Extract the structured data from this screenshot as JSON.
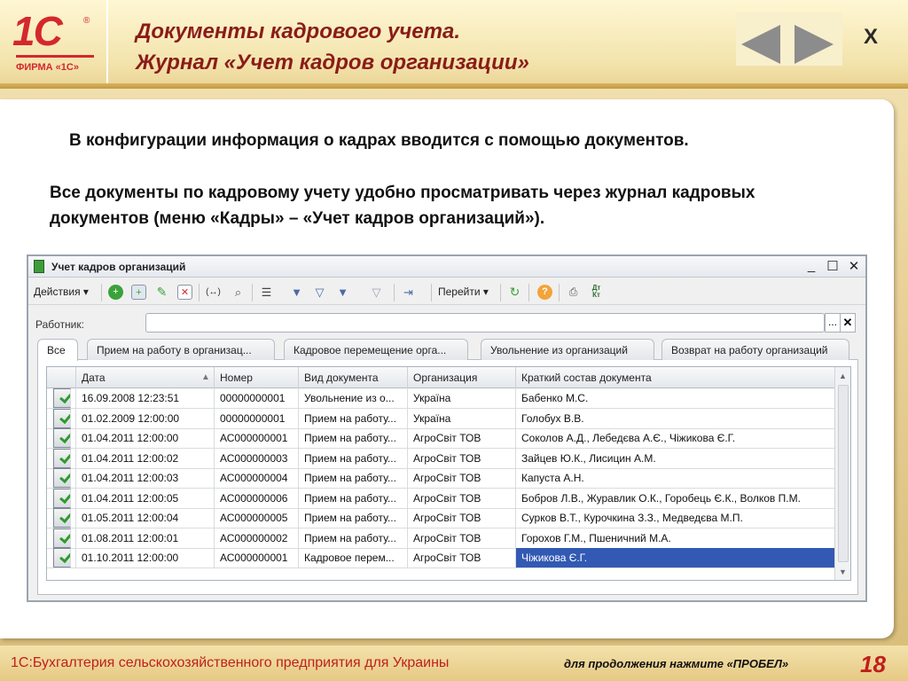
{
  "brand": {
    "logo_text": "1С",
    "registered": "®",
    "firm": "ФИРМА «1С»"
  },
  "header": {
    "title_line1": "Документы кадрового учета.",
    "title_line2": "Журнал «Учет кадров организации»",
    "close_label": "Х",
    "nav_icons": [
      "arrow-left-icon",
      "arrow-right-icon"
    ]
  },
  "body": {
    "paragraph1": "В конфигурации информация о кадрах вводится с помощью документов.",
    "paragraph2": "Все документы по кадровому учету удобно просматривать через журнал кадровых документов (меню «Кадры» – «Учет кадров организаций»)."
  },
  "window": {
    "title": "Учет кадров организаций",
    "controls": {
      "minimize": "_",
      "maximize": "☐",
      "close": "✕"
    },
    "toolbar": {
      "actions_label": "Действия ▾",
      "goto_label": "Перейти ▾"
    },
    "employee_label": "Работник:",
    "employee_value": "",
    "employee_select": "...",
    "employee_clear": "✕",
    "tabs": [
      "Все",
      "Прием на работу в организац...",
      "Кадровое перемещение орга...",
      "Увольнение из организаций",
      "Возврат на работу организаций"
    ],
    "columns": [
      "Дата",
      "Номер",
      "Вид документа",
      "Организация",
      "Краткий состав документа"
    ],
    "rows": [
      [
        "16.09.2008 12:23:51",
        "00000000001",
        "Увольнение из о...",
        "Україна",
        "Бабенко М.С."
      ],
      [
        "01.02.2009 12:00:00",
        "00000000001",
        "Прием на работу...",
        "Україна",
        "Голобух В.В."
      ],
      [
        "01.04.2011 12:00:00",
        "АС000000001",
        "Прием на работу...",
        "АгроСвіт ТОВ",
        "Соколов А.Д., Лебедєва А.Є., Чіжикова Є.Г."
      ],
      [
        "01.04.2011 12:00:02",
        "АС000000003",
        "Прием на работу...",
        "АгроСвіт ТОВ",
        "Зайцев Ю.К., Лисицин А.М."
      ],
      [
        "01.04.2011 12:00:03",
        "АС000000004",
        "Прием на работу...",
        "АгроСвіт ТОВ",
        "Капуста А.Н."
      ],
      [
        "01.04.2011 12:00:05",
        "АС000000006",
        "Прием на работу...",
        "АгроСвіт ТОВ",
        "Бобров Л.В., Журавлик О.К., Горобець Є.К., Волков П.М."
      ],
      [
        "01.05.2011 12:00:04",
        "АС000000005",
        "Прием на работу...",
        "АгроСвіт ТОВ",
        "Сурков В.Т., Курочкина З.З., Медведєва М.П."
      ],
      [
        "01.08.2011 12:00:01",
        "АС000000002",
        "Прием на работу...",
        "АгроСвіт ТОВ",
        "Горохов Г.М., Пшеничний М.А."
      ],
      [
        "01.10.2011 12:00:00",
        "АС000000001",
        "Кадровое перем...",
        "АгроСвіт ТОВ",
        "Чіжикова Є.Г."
      ]
    ],
    "selected_row": 8
  },
  "footer": {
    "product": "1С:Бухгалтерия сельскохозяйственного предприятия для Украины",
    "hint": "для продолжения нажмите «ПРОБЕЛ»",
    "page": "18"
  },
  "colors": {
    "brand_red": "#d4282d",
    "title_dark_red": "#8a1c18",
    "selection": "#3259b3",
    "check_green": "#2f9a2d"
  }
}
